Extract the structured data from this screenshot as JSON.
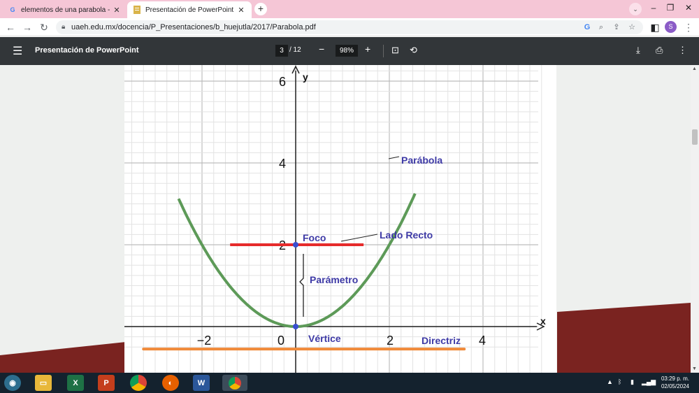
{
  "tabs": [
    {
      "title": "elementos de una parabola - Bus",
      "icon": "google-icon"
    },
    {
      "title": "Presentación de PowerPoint",
      "icon": "pdf-icon"
    }
  ],
  "address": {
    "url": "uaeh.edu.mx/docencia/P_Presentaciones/b_huejutla/2017/Parabola.pdf"
  },
  "profile": {
    "initial": "S"
  },
  "pdf_toolbar": {
    "title": "Presentación de PowerPoint",
    "page": "3",
    "page_total": "/ 12",
    "zoom": "98%"
  },
  "chart_data": {
    "type": "line",
    "title": "",
    "xlabel": "x",
    "ylabel": "y",
    "x_ticks": [
      "−2",
      "0",
      "2",
      "4"
    ],
    "y_ticks": [
      "6",
      "4",
      "2"
    ],
    "xlim": [
      -3.7,
      5.3
    ],
    "ylim": [
      -0.6,
      6.3
    ],
    "series": [
      {
        "name": "Parábola",
        "equation": "y = x^2 / 2",
        "x": [
          -2.4,
          -2,
          -1.5,
          -1,
          -0.5,
          0,
          0.5,
          1,
          1.5,
          2,
          2.5,
          3.5
        ],
        "y": [
          2.88,
          2,
          1.125,
          0.5,
          0.125,
          0,
          0.125,
          0.5,
          1.125,
          2,
          3.125,
          6.125
        ]
      }
    ],
    "lado_recto": {
      "x1": -1.4,
      "x2": 1.45,
      "y": 2
    },
    "directriz": {
      "x1": -3.25,
      "x2": 3.6,
      "y": -0.55
    },
    "foco": {
      "x": 0,
      "y": 2
    },
    "vertice": {
      "x": 0,
      "y": 0
    },
    "annotations": [
      "Parábola",
      "Lado Recto",
      "Foco",
      "Parámetro",
      "Vértice",
      "Directriz"
    ],
    "colors": {
      "parabola": "#5d9a58",
      "lado_recto": "#e62b2b",
      "directriz": "#f08a3a",
      "labels": "#3e3aa6"
    }
  },
  "taskbar": {
    "apps": [
      "windows-start",
      "file-explorer",
      "excel",
      "powerpoint",
      "chrome",
      "firefox",
      "word",
      "chrome-profile"
    ],
    "time": "03:29 p. m.",
    "date": "02/05/2024"
  }
}
